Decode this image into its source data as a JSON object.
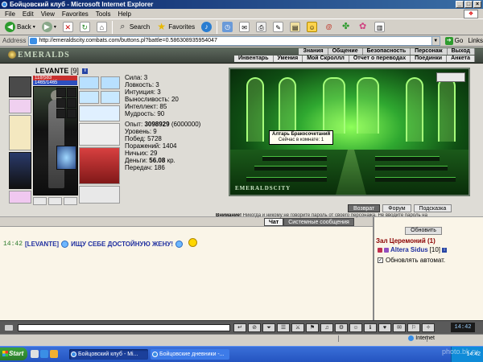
{
  "window": {
    "title": "Бойцовский клуб - Microsoft Internet Explorer"
  },
  "menu": [
    "File",
    "Edit",
    "View",
    "Favorites",
    "Tools",
    "Help"
  ],
  "toolbar": {
    "back_label": "Back",
    "search_label": "Search",
    "favorites_label": "Favorites"
  },
  "address": {
    "label": "Address",
    "url": "http://emeraldscity.combats.com/buttons.pl?battle=0.586308935954047",
    "go_label": "Go",
    "links_label": "Links"
  },
  "game": {
    "logo": "EMERALDS",
    "nav_top": [
      "Знания",
      "Общение",
      "Безопасность",
      "Персонаж",
      "Выход"
    ],
    "nav_bottom": [
      "Инвентарь",
      "Умения",
      "Мой Скроллл",
      "Отчет о переводах",
      "Поединки",
      "Анкета"
    ]
  },
  "character": {
    "name": "LEVANTE",
    "level": "[9]",
    "badge": "i",
    "hp": "118/583",
    "mp": "1465/1465",
    "stats": [
      "Сила: 3",
      "Ловкость: 3",
      "Интуиция: 3",
      "Выносливость: 20",
      "Интеллект: 85",
      "Мудрость: 90"
    ],
    "exp_label": "Опыт:",
    "exp_value": "3098929",
    "exp_next": "(6000000)",
    "level_line": "Уровень: 9",
    "wins": "Побед: 5728",
    "losses": "Поражений: 1404",
    "draws": "Ничьих: 29",
    "money_label": "Деньги:",
    "money_value": "56.08",
    "money_unit": "кр.",
    "transfers": "Передач: 186"
  },
  "scene": {
    "watermark": "EMERALDSCITY",
    "tooltip_title": "Алтарь Бракосочетаний",
    "tooltip_text": "Сейчас в комнате: 1",
    "buttons": [
      "Возврат",
      "Форум",
      "Подсказка"
    ]
  },
  "warning": {
    "bold": "Внимание!",
    "text": " Никогда и никому не говорите пароль от своего персонажа. Не вводите пароль на"
  },
  "chat": {
    "tabs": [
      "Чат",
      "Системные сообщения"
    ],
    "time": "14:42",
    "nick": "[LEVANTE]",
    "message": "ИЩУ СЕБЕ ДОСТОЙНУЮ ЖЕНУ!"
  },
  "room": {
    "refresh_label": "Обновить",
    "title": "Зал Церемоний (1)",
    "user_name": "Altera Sidus",
    "user_level": "[10]",
    "user_badge": "i",
    "auto_refresh_label": "Обновлять автомат."
  },
  "bottombar": {
    "clock": "14:42"
  },
  "status": {
    "zone": "Internet"
  },
  "taskbar": {
    "start_label": "Start",
    "task1": "Бойцовский клуб - Mi...",
    "task2": "Бойцовские дневники -...",
    "tray_time": "14:42"
  },
  "overlay": {
    "watermark": "photo.bk.ru"
  }
}
